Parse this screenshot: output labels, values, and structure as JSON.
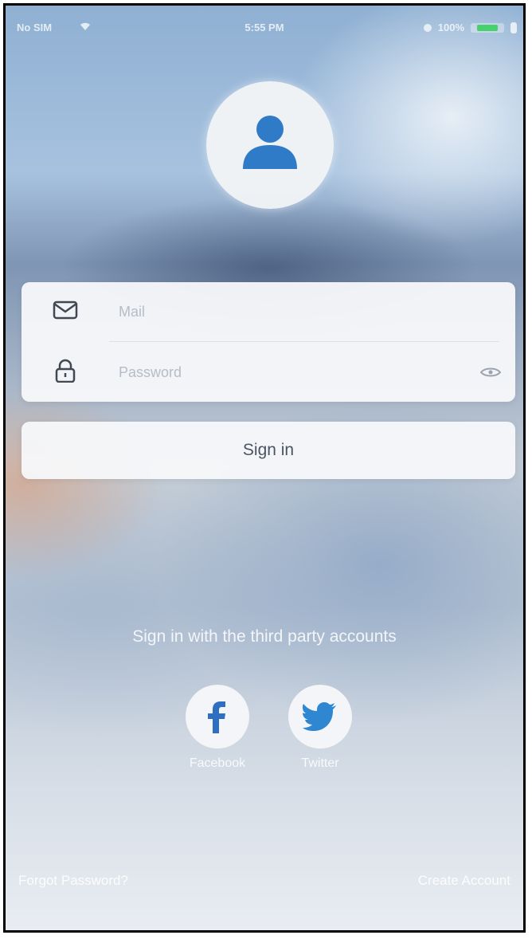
{
  "status_bar": {
    "carrier": "No SIM",
    "time": "5:55 PM",
    "battery": "100%"
  },
  "login": {
    "email_placeholder": "Mail",
    "password_placeholder": "Password",
    "sign_in_label": "Sign in"
  },
  "third_party": {
    "label": "Sign in with the third party accounts",
    "facebook_label": "Facebook",
    "twitter_label": "Twitter"
  },
  "footer": {
    "forgot_label": "Forgot Password?",
    "create_label": "Create Account"
  },
  "colors": {
    "avatar_blue": "#2f7bc8",
    "facebook_blue": "#2e6fc1",
    "twitter_blue": "#2f86d1",
    "battery_green": "#47d16c"
  },
  "icons": {
    "avatar": "person-icon",
    "email": "mail-icon",
    "password": "lock-icon",
    "password_toggle": "eye-icon",
    "facebook": "facebook-icon",
    "twitter": "twitter-icon"
  }
}
